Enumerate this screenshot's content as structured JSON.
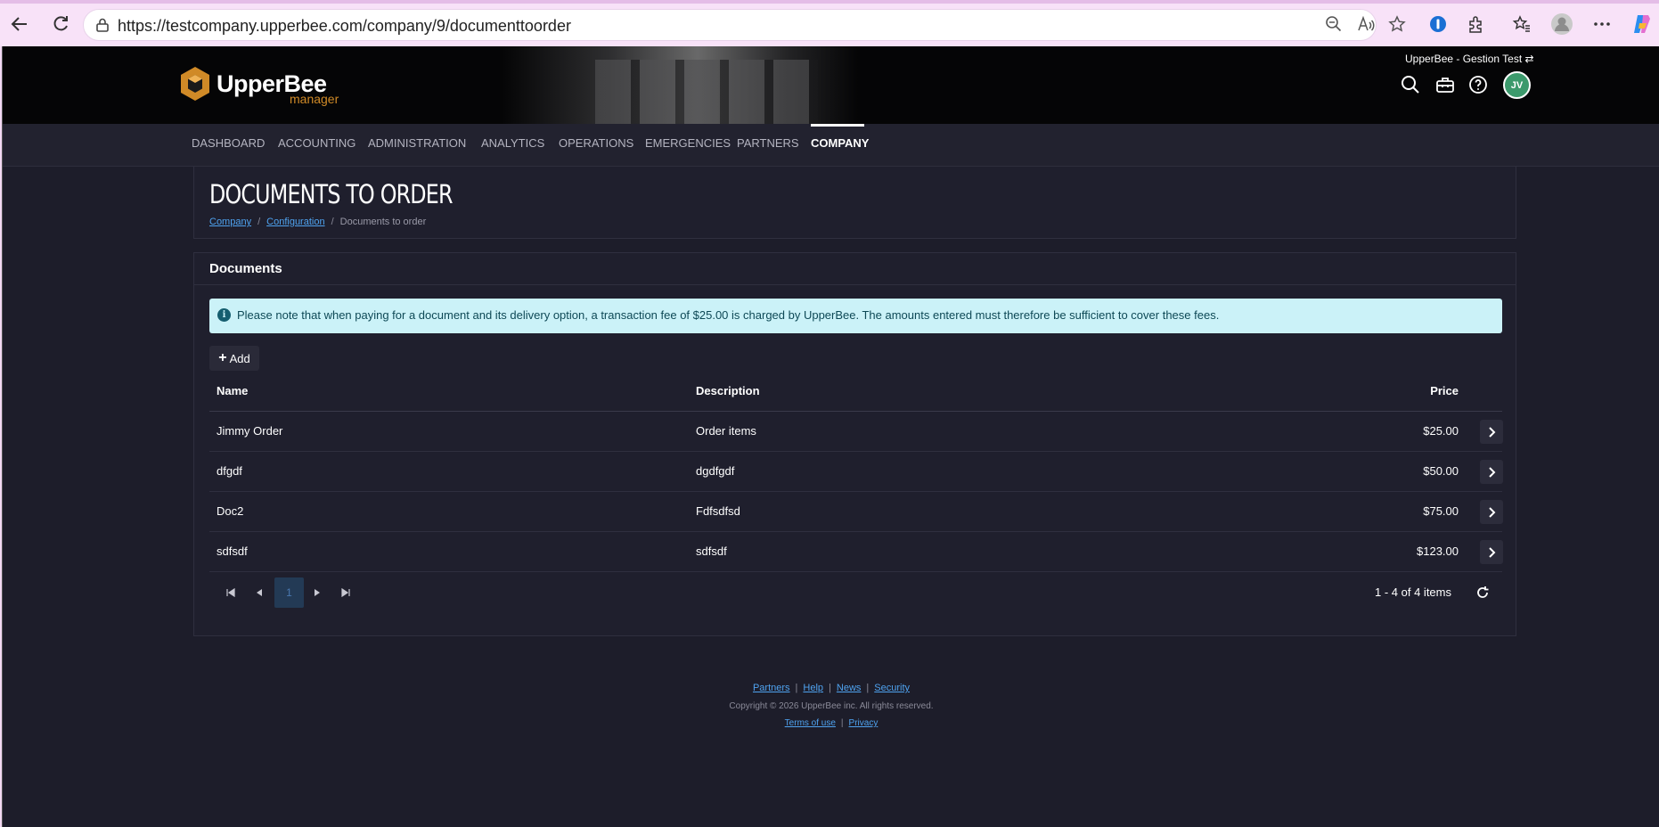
{
  "browser": {
    "url": "https://testcompany.upperbee.com/company/9/documenttoorder"
  },
  "header": {
    "brand": "UpperBee",
    "brand_sub": "manager",
    "company_switch": "UpperBee - Gestion Test",
    "avatar_initials": "JV"
  },
  "nav": {
    "items": [
      "DASHBOARD",
      "ACCOUNTING",
      "ADMINISTRATION",
      "ANALYTICS",
      "OPERATIONS",
      "EMERGENCIES",
      "PARTNERS",
      "COMPANY"
    ],
    "active": "COMPANY"
  },
  "page": {
    "title": "DOCUMENTS TO ORDER",
    "breadcrumb": [
      "Company",
      "Configuration",
      "Documents to order"
    ]
  },
  "documents": {
    "heading": "Documents",
    "alert": "Please note that when paying for a document and its delivery option, a transaction fee of $25.00 is charged by UpperBee. The amounts entered must therefore be sufficient to cover these fees.",
    "add_label": "Add",
    "columns": {
      "name": "Name",
      "description": "Description",
      "price": "Price"
    },
    "rows": [
      {
        "name": "Jimmy Order",
        "description": "Order items",
        "price": "$25.00"
      },
      {
        "name": "dfgdf",
        "description": "dgdfgdf",
        "price": "$50.00"
      },
      {
        "name": "Doc2",
        "description": "Fdfsdfsd",
        "price": "$75.00"
      },
      {
        "name": "sdfsdf",
        "description": "sdfsdf",
        "price": "$123.00"
      }
    ],
    "pager": {
      "current_page": "1",
      "info": "1 - 4 of 4 items"
    }
  },
  "footer": {
    "links": [
      "Partners",
      "Help",
      "News",
      "Security"
    ],
    "copyright": "Copyright © 2026 UpperBee inc. All rights reserved.",
    "legal": [
      "Terms of use",
      "Privacy"
    ]
  },
  "colors": {
    "accent": "#4fa3f0",
    "brand_orange": "#d08a27",
    "background": "#1d1d2a",
    "alert_bg": "#cbf2f8"
  }
}
